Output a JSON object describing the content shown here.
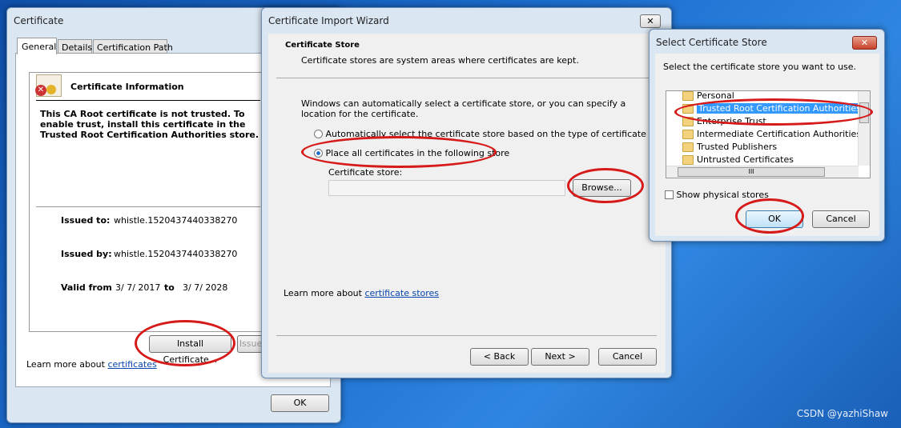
{
  "certificate": {
    "title": "Certificate",
    "tabs": [
      "General",
      "Details",
      "Certification Path"
    ],
    "info_heading": "Certificate Information",
    "warning": "This CA Root certificate is not trusted. To enable trust, install this certificate in the Trusted Root Certification Authorities store.",
    "issued_to_label": "Issued to:",
    "issued_to": "whistle.1520437440338270",
    "issued_by_label": "Issued by:",
    "issued_by": "whistle.1520437440338270",
    "valid_from_label": "Valid from",
    "valid_from": "3/ 7/ 2017",
    "to_label": "to",
    "valid_to": "3/ 7/ 2028",
    "install_button": "Install Certificate...",
    "issuer_button": "Issuer Statement",
    "learn_more": "Learn more about ",
    "learn_more_link": "certificates",
    "ok_button": "OK"
  },
  "wizard": {
    "title": "Certificate Import Wizard",
    "heading": "Certificate Store",
    "subheading": "Certificate stores are system areas where certificates are kept.",
    "description": "Windows can automatically select a certificate store, or you can specify a location for the certificate.",
    "option_auto": "Automatically select the certificate store based on the type of certificate",
    "option_manual": "Place all certificates in the following store",
    "selected_option": "option_manual",
    "store_label": "Certificate store:",
    "store_value": "",
    "browse_button": "Browse...",
    "learn_more": "Learn more about ",
    "learn_more_link": "certificate stores",
    "back_button": "< Back",
    "next_button": "Next >",
    "cancel_button": "Cancel"
  },
  "select_store": {
    "title": "Select Certificate Store",
    "prompt": "Select the certificate store you want to use.",
    "stores": [
      "Personal",
      "Trusted Root Certification Authorities",
      "Enterprise Trust",
      "Intermediate Certification Authorities",
      "Trusted Publishers",
      "Untrusted Certificates"
    ],
    "selected": "Trusted Root Certification Authorities",
    "show_physical": "Show physical stores",
    "show_physical_checked": false,
    "ok_button": "OK",
    "cancel_button": "Cancel"
  },
  "watermark": "CSDN @yazhiShaw",
  "colors": {
    "annotation": "#d61a1a",
    "selection": "#3399ff"
  }
}
